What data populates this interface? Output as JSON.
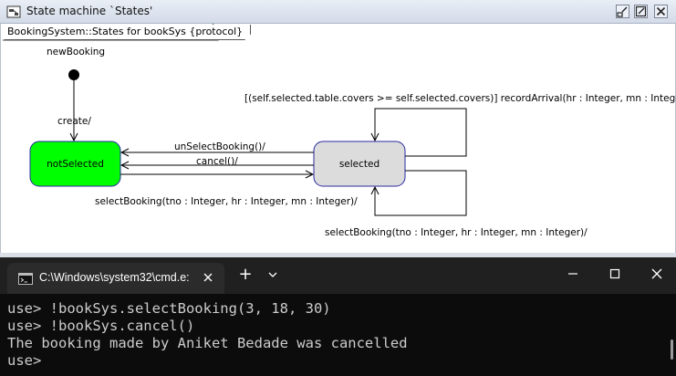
{
  "sm_window": {
    "title": "State machine `States'",
    "frame_label": "BookingSystem::States for bookSys {protocol}"
  },
  "diagram": {
    "initial_label": "newBooking",
    "create_label": "create/",
    "states": {
      "not_selected": "notSelected",
      "selected": "selected"
    },
    "transitions": {
      "unselect": "unSelectBooking()/",
      "cancel": "cancel()/",
      "select": "selectBooking(tno : Integer, hr : Integer, mn : Integer)/",
      "record_arrival": "[(self.selected.table.covers >= self.selected.covers)] recordArrival(hr : Integer, mn : Integer)/",
      "self_select": "selectBooking(tno : Integer, hr : Integer, mn : Integer)/"
    },
    "colors": {
      "not_selected_fill": "#00ff00",
      "selected_fill": "#dcdcdc",
      "state_border": "#2a2aa0"
    }
  },
  "terminal": {
    "tab_title": "C:\\Windows\\system32\\cmd.e:",
    "new_tab": "+",
    "lines": [
      "use> !bookSys.selectBooking(3, 18, 30)",
      "use> !bookSys.cancel()",
      "The booking made by Aniket Bedade was cancelled",
      "use>"
    ]
  }
}
